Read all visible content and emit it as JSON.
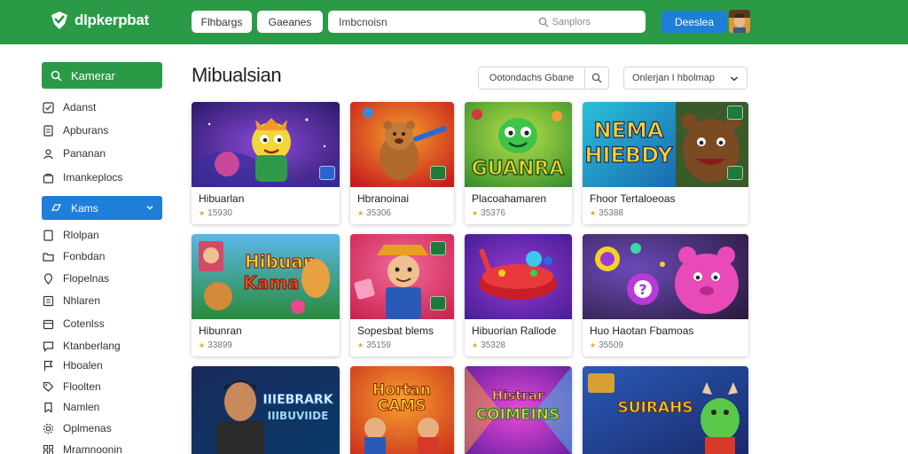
{
  "header": {
    "brand": "dlpkerpbat",
    "nav_pills": [
      "Flhbargs",
      "Gaeanes"
    ],
    "search_label": "Imbcnoisn",
    "search_hint": "Sanplors",
    "action_button": "Deeslea"
  },
  "sidebar": {
    "top_item": "Kamerar",
    "group1": [
      "Adanst",
      "Apburans",
      "Pananan",
      "Imankeplocs"
    ],
    "section_item": "Kams",
    "group2": [
      "Rlolpan",
      "Fonbdan",
      "Flopelnas",
      "Nhlaren",
      "Cotenlss",
      "Ktanberlang",
      "Hboalen",
      "Floolten",
      "Namlen",
      "Oplmenas",
      "Mramnoonin"
    ]
  },
  "main": {
    "title": "Mibualsian",
    "filter_label": "Ootondachs Gbane",
    "sort_label": "Onlerjan I hbolmap"
  },
  "games": [
    {
      "title": "Hibuarlan",
      "meta": "15930"
    },
    {
      "title": "Hbranoinai",
      "meta": "35306"
    },
    {
      "title": "Placoahamaren",
      "meta": "35376"
    },
    {
      "title": "Fhoor Tertaloeoas",
      "meta": "35388"
    },
    {
      "title": "Hibunran",
      "meta": "33899"
    },
    {
      "title": "Sopesbat blems",
      "meta": "35159"
    },
    {
      "title": "Hibuorian Rallode",
      "meta": "35328"
    },
    {
      "title": "Huo Haotan Fbamoas",
      "meta": "35509"
    },
    {
      "title": "",
      "meta": ""
    },
    {
      "title": "",
      "meta": ""
    },
    {
      "title": "",
      "meta": ""
    },
    {
      "title": "",
      "meta": ""
    }
  ],
  "thumb_text": {
    "g3": "GUANRA",
    "g4a": "NEMA",
    "g4b": "HIEBDY",
    "g5a": "Hibuan",
    "g5b": "Kama",
    "g9a": "IIIEBRARK",
    "g9b": "IIIBUVIIDE",
    "g10a": "Hortan",
    "g10b": "CAMS",
    "g11a": "Histrar",
    "g11b": "COIMEINS",
    "g12": "SUIRAHS"
  },
  "colors": {
    "brand_green": "#2b9a47",
    "accent_blue": "#1e7fd8"
  }
}
